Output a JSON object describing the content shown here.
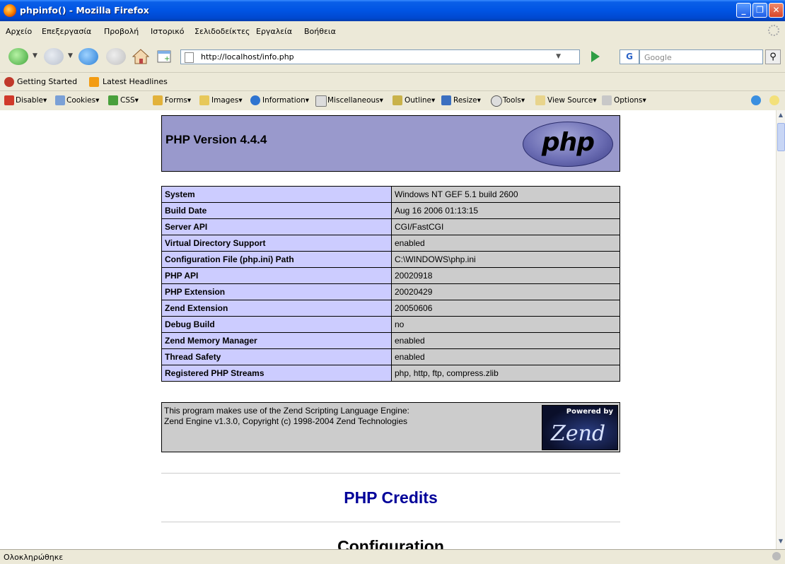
{
  "window": {
    "title": "phpinfo() - Mozilla Firefox"
  },
  "menu": [
    "Αρχείο",
    "Επεξεργασία",
    "Προβολή",
    "Ιστορικό",
    "Σελιδοδείκτες",
    "Εργαλεία",
    "Βοήθεια"
  ],
  "navbar": {
    "url": "http://localhost/info.php",
    "search_placeholder": "Google",
    "search_engine": "G"
  },
  "bookmarks": [
    "Getting Started",
    "Latest Headlines"
  ],
  "devbar": [
    "Disable",
    "Cookies",
    "CSS",
    "Forms",
    "Images",
    "Information",
    "Miscellaneous",
    "Outline",
    "Resize",
    "Tools",
    "View Source",
    "Options"
  ],
  "page": {
    "version_title": "PHP Version 4.4.4",
    "php_logo_text": "php",
    "info_rows": [
      {
        "label": "System",
        "value": "Windows NT GEF 5.1 build 2600"
      },
      {
        "label": "Build Date",
        "value": "Aug 16 2006 01:13:15"
      },
      {
        "label": "Server API",
        "value": "CGI/FastCGI"
      },
      {
        "label": "Virtual Directory Support",
        "value": "enabled"
      },
      {
        "label": "Configuration File (php.ini) Path",
        "value": "C:\\WINDOWS\\php.ini"
      },
      {
        "label": "PHP API",
        "value": "20020918"
      },
      {
        "label": "PHP Extension",
        "value": "20020429"
      },
      {
        "label": "Zend Extension",
        "value": "20050606"
      },
      {
        "label": "Debug Build",
        "value": "no"
      },
      {
        "label": "Zend Memory Manager",
        "value": "enabled"
      },
      {
        "label": "Thread Safety",
        "value": "enabled"
      },
      {
        "label": "Registered PHP Streams",
        "value": "php, http, ftp, compress.zlib"
      }
    ],
    "zend_line1": "This program makes use of the Zend Scripting Language Engine:",
    "zend_line2": "Zend Engine v1.3.0, Copyright (c) 1998-2004 Zend Technologies",
    "zend_logo_top": "Powered by",
    "zend_logo_name": "Zend",
    "credits_link": "PHP Credits",
    "config_heading": "Configuration"
  },
  "status": {
    "text": "Ολοκληρώθηκε"
  }
}
